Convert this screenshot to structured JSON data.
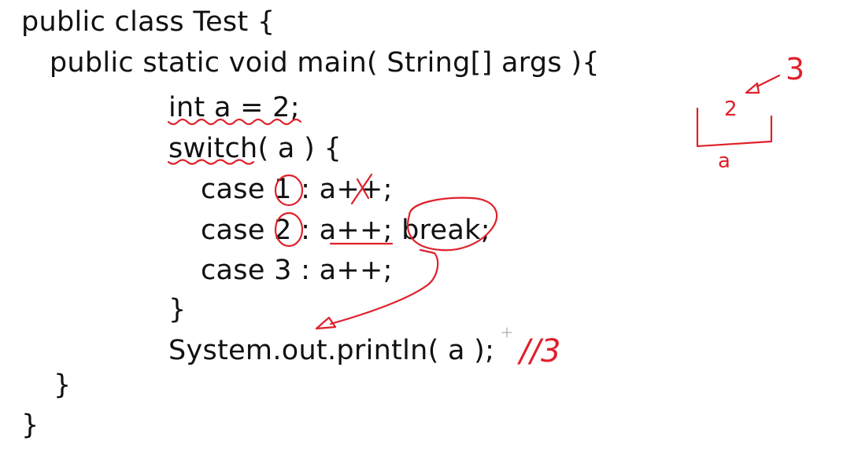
{
  "code": {
    "lines": [
      "public class Test {",
      "  public static void main( String[] args ){",
      "int a = 2;",
      "switch( a ) {",
      "case 1 : a++;",
      "case 2 : a++; break;",
      "case 3 : a++;",
      "}",
      "System.out.println( a );",
      "}",
      "}"
    ]
  },
  "annotations": {
    "result_comment": "//3",
    "memory_value_old": "2",
    "memory_value_new": "3",
    "memory_label": "a",
    "ink_color": "#e0202a"
  }
}
